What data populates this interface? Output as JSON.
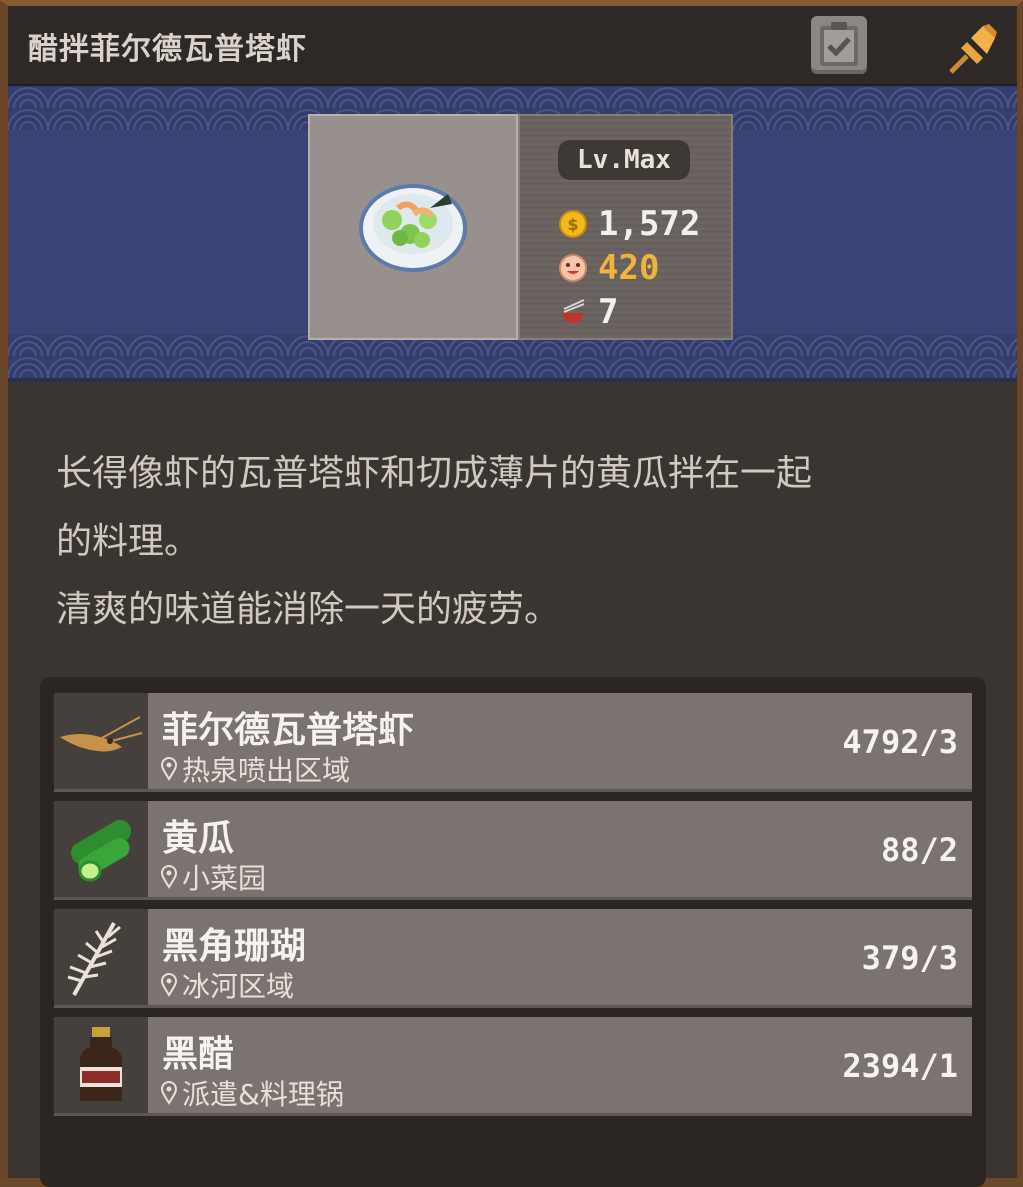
{
  "window": {
    "title": "醋拌菲尔德瓦普塔虾"
  },
  "dish": {
    "level_label": "Lv.Max",
    "price": "1,572",
    "taste": "420",
    "servings": "7",
    "colors": {
      "price": "#f2f0ee",
      "taste": "#f0b33c"
    }
  },
  "description": {
    "line1": "长得像虾的瓦普塔虾和切成薄片的黄瓜拌在一起",
    "line2": "的料理。",
    "line3": "清爽的味道能消除一天的疲劳。"
  },
  "ingredients": [
    {
      "name": "菲尔德瓦普塔虾",
      "location": "热泉喷出区域",
      "count": "4792/3",
      "icon": "shrimp-icon"
    },
    {
      "name": "黄瓜",
      "location": "小菜园",
      "count": "88/2",
      "icon": "cucumber-icon"
    },
    {
      "name": "黑角珊瑚",
      "location": "冰河区域",
      "count": "379/3",
      "icon": "coral-icon"
    },
    {
      "name": "黑醋",
      "location": "派遣&料理锅",
      "count": "2394/1",
      "icon": "vinegar-bottle-icon"
    }
  ]
}
